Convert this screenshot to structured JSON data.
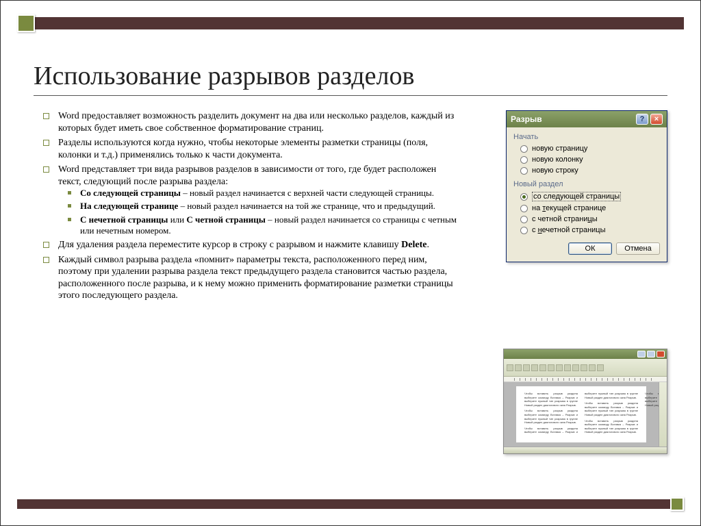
{
  "title": "Использование разрывов разделов",
  "bullets": {
    "b1": "Word предоставляет возможность разделить документ на два или несколько разделов, каждый из которых будет иметь свое собственное форматирование страниц.",
    "b2": "Разделы используются когда нужно, чтобы некоторые элементы разметки страницы (поля, колонки и т.д.) применялись только к части документа.",
    "b3": "Word представляет три вида разрывов разделов в зависимости от того, где будет расположен текст, следующий после разрыва раздела:",
    "b3a_bold": "Со следующей страницы",
    "b3a_rest": " – новый раздел начинается с верхней части следующей страницы.",
    "b3b_bold": "На следующей странице",
    "b3b_rest": " – новый раздел начинается на той же странице, что и предыдущий.",
    "b3c_bold1": "С нечетной страницы",
    "b3c_mid": " или ",
    "b3c_bold2": "С четной страницы",
    "b3c_rest": " – новый раздел начинается со страницы с четным или нечетным номером.",
    "b4_pre": "Для удаления раздела переместите курсор в строку с разрывом и нажмите клавишу ",
    "b4_bold": "Delete",
    "b4_post": ".",
    "b5": "Каждый символ разрыва раздела «помнит» параметры текста, расположенного перед ним, поэтому при удалении разрыва раздела текст предыдущего раздела становится частью раздела, расположенного после разрыва, и к нему можно применить форматирование разметки страницы этого последующего раздела."
  },
  "dialog": {
    "title": "Разрыв",
    "group1": "Начать",
    "opt1": "новую страницу",
    "opt2": "новую колонку",
    "opt3": "новую строку",
    "group2": "Новый раздел",
    "opt4_pre": "со сле",
    "opt4_ul": "д",
    "opt4_post": "ующей страницы",
    "opt5_pre": "на ",
    "opt5_ul": "т",
    "opt5_post": "екущей странице",
    "opt6_pre": "с четной страни",
    "opt6_ul": "ц",
    "opt6_post": "ы",
    "opt7_pre": "с ",
    "opt7_ul": "н",
    "opt7_post": "ечетной страницы",
    "ok": "ОК",
    "cancel": "Отмена"
  },
  "wordwin": {
    "filler": "Чтобы вставить разрыв раздела выберите команду Вставка – Разрыв и выберите нужный тип разрыва в группе Новый раздел диалогового окна Разрыв."
  }
}
